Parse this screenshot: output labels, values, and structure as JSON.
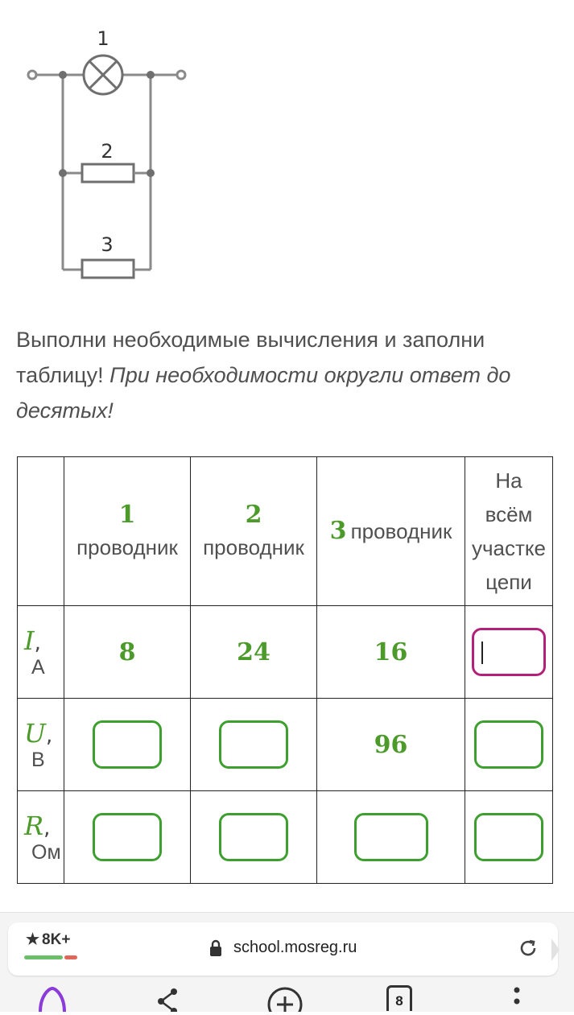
{
  "diagram": {
    "label_1": "1",
    "label_2": "2",
    "label_3": "3"
  },
  "task": {
    "text": "Выполни необходимые вычисления и заполни таблицу! ",
    "hint": "При необходимости округли ответ до десятых!"
  },
  "table": {
    "columns": [
      {
        "num": "1",
        "word": "проводник"
      },
      {
        "num": "2",
        "word": "проводник"
      },
      {
        "num": "3",
        "word": "проводник"
      }
    ],
    "last_column": [
      "На",
      "всём",
      "участке",
      "цепи"
    ],
    "rows": [
      {
        "symbol": "I",
        "unit": "А",
        "values": [
          "8",
          "24",
          "16",
          ""
        ]
      },
      {
        "symbol": "U",
        "unit": "В",
        "values": [
          "",
          "",
          "96",
          ""
        ]
      },
      {
        "symbol": "R",
        "unit": "Ом",
        "values": [
          "",
          "",
          "",
          ""
        ]
      }
    ]
  },
  "browser": {
    "rating": "8K+",
    "url": "school.mosreg.ru",
    "tabs_count": "8"
  },
  "colors": {
    "accent_green": "#4c9a2a",
    "input_border": "#3da02e",
    "active_input_border": "#b3207a"
  }
}
